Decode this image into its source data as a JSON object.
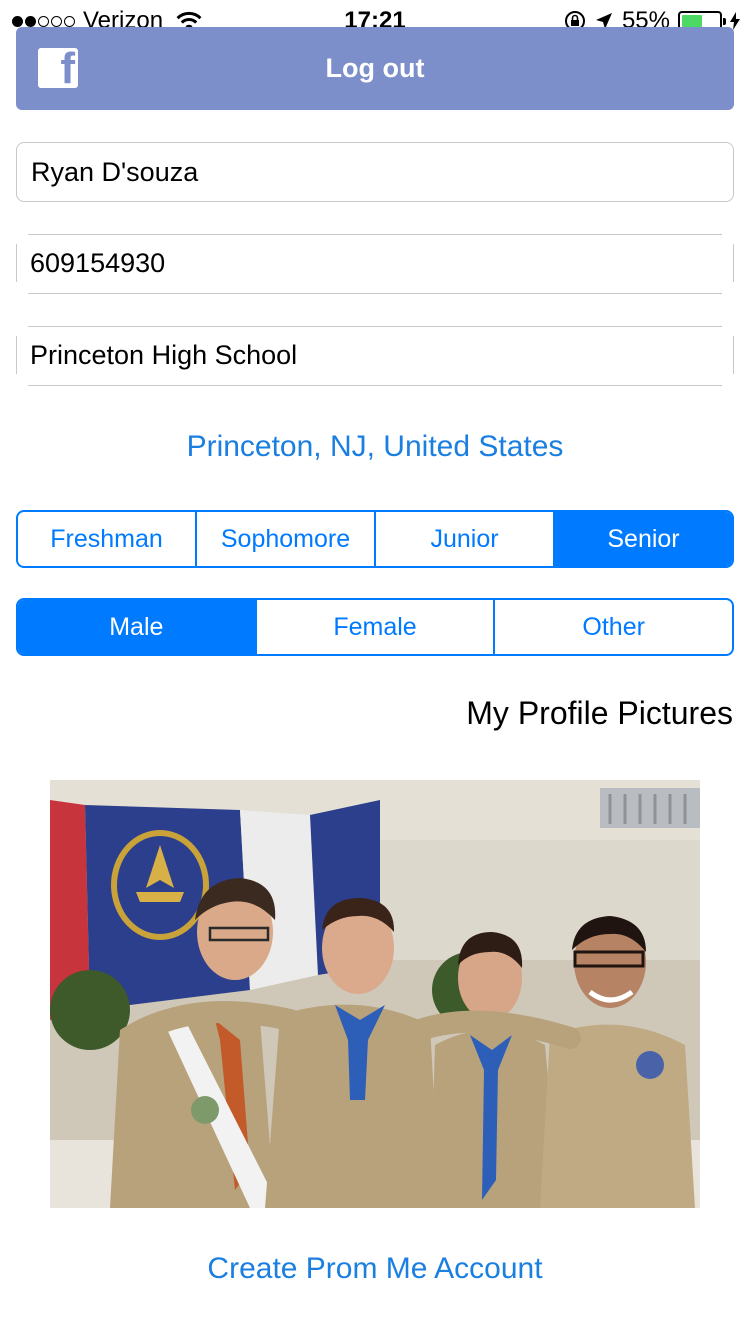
{
  "status_bar": {
    "carrier": "Verizon",
    "time": "17:21",
    "battery_percent": "55%",
    "battery_level": 0.55,
    "signal_bars_filled": 2,
    "signal_bars_total": 5
  },
  "facebook": {
    "icon": "facebook-icon",
    "logout_label": "Log out",
    "bar_color": "#7d8fca"
  },
  "fields": {
    "name": "Ryan D'souza",
    "phone": "609154930",
    "school": "Princeton High School"
  },
  "location": "Princeton, NJ, United States",
  "grade": {
    "options": [
      "Freshman",
      "Sophomore",
      "Junior",
      "Senior"
    ],
    "selected": "Senior"
  },
  "gender": {
    "options": [
      "Male",
      "Female",
      "Other"
    ],
    "selected": "Male"
  },
  "profile_pictures_title": "My Profile Pictures",
  "create_account_label": "Create Prom Me Account",
  "colors": {
    "accent": "#007aff",
    "link": "#1a7fe0",
    "battery": "#4cd964"
  }
}
